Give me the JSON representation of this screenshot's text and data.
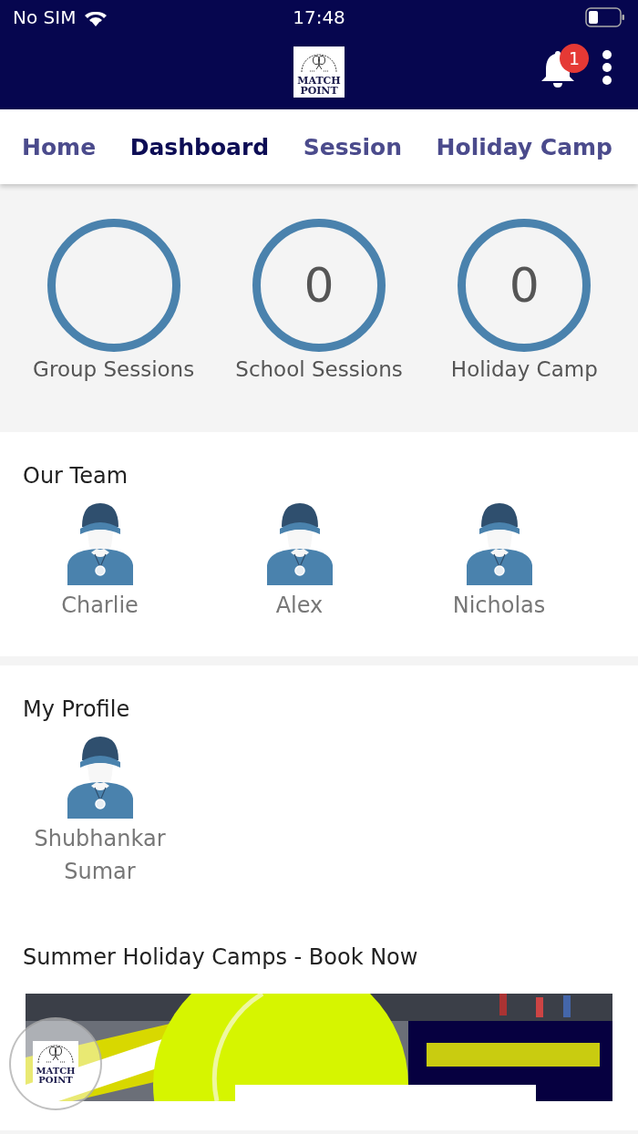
{
  "status_bar": {
    "carrier": "No SIM",
    "time": "17:48"
  },
  "app_bar": {
    "logo": {
      "line1": "MATCH",
      "line2": "POINT"
    },
    "notifications": "1"
  },
  "floating_button": {
    "logo": {
      "line1": "MATCH",
      "line2": "POINT"
    }
  },
  "tabs": [
    {
      "label": "Home",
      "selected": false
    },
    {
      "label": "Dashboard",
      "selected": true
    },
    {
      "label": "Session",
      "selected": false
    },
    {
      "label": "Holiday Camp",
      "selected": false
    }
  ],
  "stats": [
    {
      "label": "Group Sessions"
    },
    {
      "label": "School Sessions",
      "value": "0"
    },
    {
      "label": "Holiday Camp",
      "value": "0"
    }
  ],
  "team": {
    "title": "Our Team",
    "members": [
      {
        "name": "Charlie"
      },
      {
        "name": "Alex"
      },
      {
        "name": "Nicholas"
      }
    ]
  },
  "profile": {
    "title": "My Profile",
    "name": "Shubhankar Sumar"
  },
  "banner": {
    "title": "Summer Holiday Camps - Book Now"
  }
}
